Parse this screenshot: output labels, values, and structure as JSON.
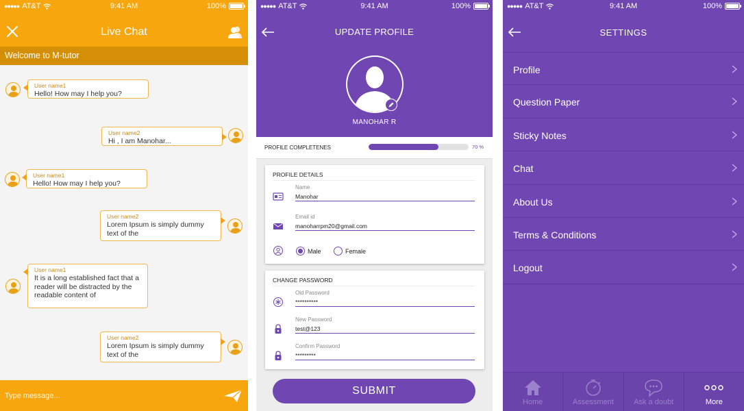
{
  "status_bar": {
    "carrier": "AT&T",
    "time": "9:41 AM",
    "battery": "100%"
  },
  "chat": {
    "title": "Live Chat",
    "welcome": "Welcome to M-tutor",
    "messages": [
      {
        "side": "left",
        "user": "User name1",
        "text": "Hello! How may I help you?"
      },
      {
        "side": "right",
        "user": "User name2",
        "text": "Hi , I am Manohar..."
      },
      {
        "side": "left",
        "user": "User name1",
        "text": "Hello! How may I help you?"
      },
      {
        "side": "right",
        "user": "User name2",
        "text": "Lorem Ipsum is simply dummy text of the"
      },
      {
        "side": "left",
        "user": "User name1",
        "text": "It is a long established fact that a reader will be distracted by the readable content of"
      },
      {
        "side": "right",
        "user": "User name2",
        "text": "Lorem Ipsum is simply dummy text of the"
      }
    ],
    "composer_placeholder": "Type message...",
    "colors": {
      "accent": "#f7a70d",
      "accent_dark": "#d48f06"
    }
  },
  "profile": {
    "title": "UPDATE PROFILE",
    "user_name": "MANOHAR R",
    "completeness_label": "PROFILE COMPLETENES",
    "completeness_value": "70 %",
    "completeness_fraction": 0.7,
    "details": {
      "title": "PROFILE DETAILS",
      "name_label": "Name",
      "name_value": "Manohar",
      "email_label": "Email id",
      "email_value": "manoharrpm20@gmail.com",
      "gender_options": [
        "Male",
        "Female"
      ],
      "gender_selected": "Male"
    },
    "password": {
      "title": "CHANGE PASSWORD",
      "old_label": "Old Password",
      "old_value": "**********",
      "new_label": "New Password",
      "new_value": "test@123",
      "confirm_label": "Confirm Password",
      "confirm_value": "*********"
    },
    "submit_label": "SUBMIT",
    "colors": {
      "accent": "#6f46b2"
    }
  },
  "settings": {
    "title": "SETTINGS",
    "menu": [
      "Profile",
      "Question Paper",
      "Sticky Notes",
      "Chat",
      "About Us",
      "Terms & Conditions",
      "Logout"
    ],
    "tabs": [
      {
        "label": "Home",
        "icon": "home-icon"
      },
      {
        "label": "Assessment",
        "icon": "stopwatch-icon"
      },
      {
        "label": "Ask a doubt",
        "icon": "chat-bubble-icon"
      },
      {
        "label": "More",
        "icon": "more-dots-icon"
      }
    ],
    "active_tab": "More"
  }
}
